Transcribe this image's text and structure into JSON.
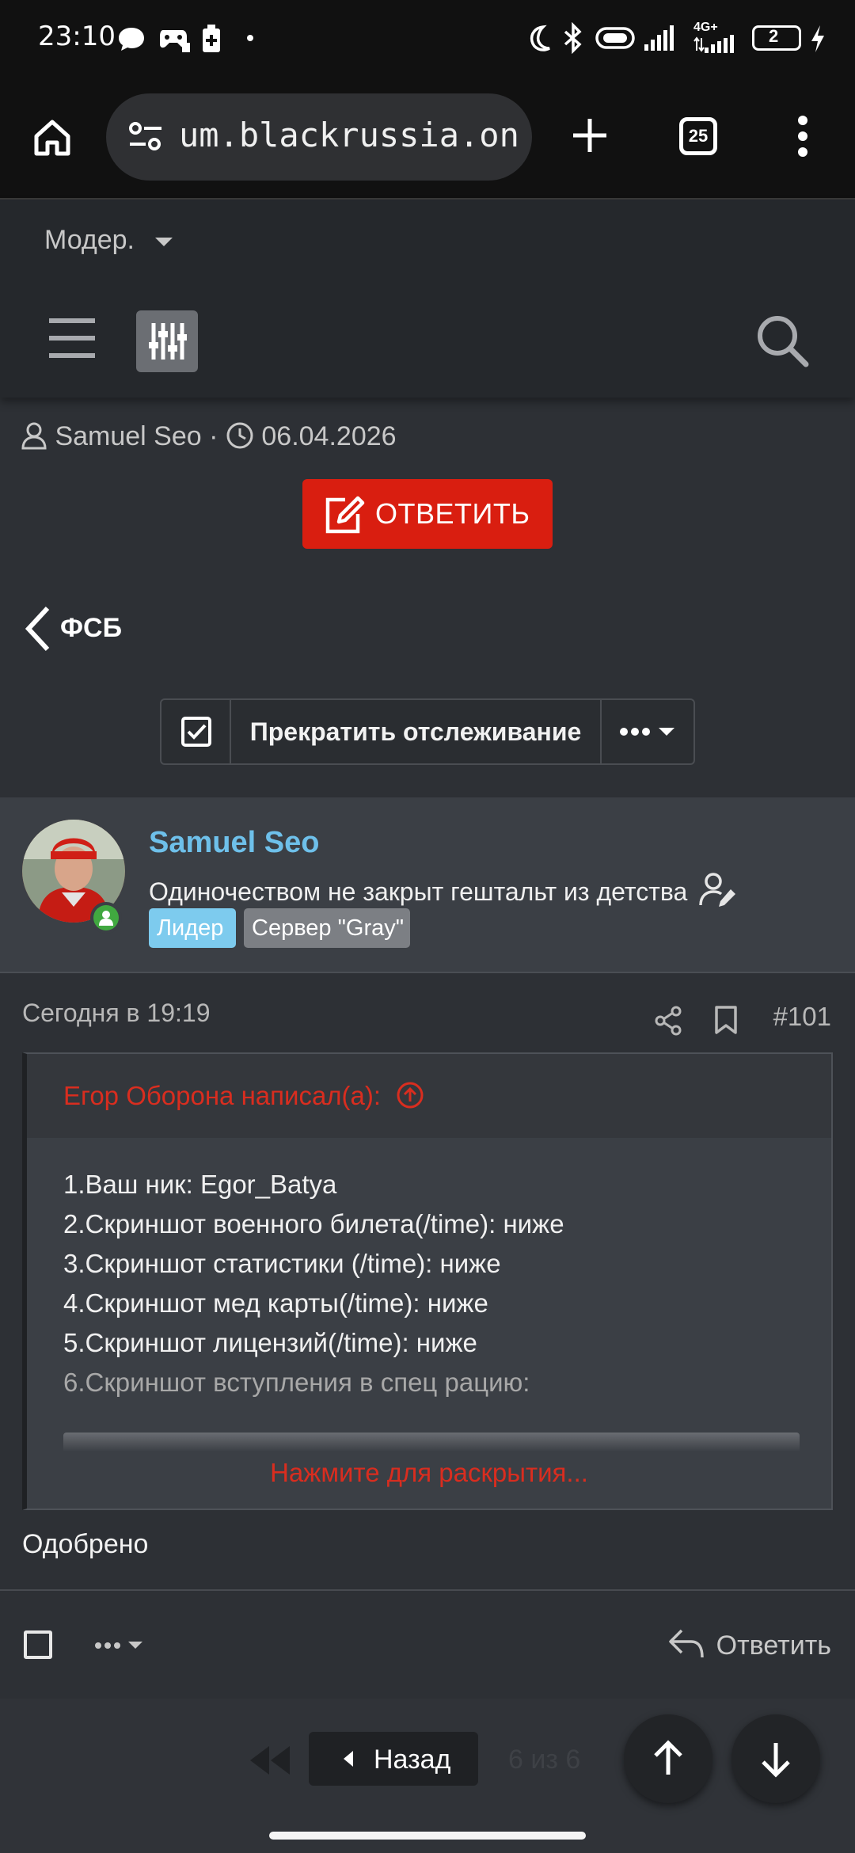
{
  "status_bar": {
    "time": "23:10",
    "network": "4G+",
    "battery": "2"
  },
  "browser": {
    "url": "um.blackrussia.online",
    "tab_count": "25"
  },
  "site_header": {
    "mod_label": "Модер."
  },
  "thread": {
    "author": "Samuel Seo",
    "separator": "·",
    "date": "06.04.2026",
    "reply_label": "ОТВЕТИТЬ",
    "back_forum": "ФСБ",
    "watch_label": "Прекратить отслеживание"
  },
  "post": {
    "username": "Samuel Seo",
    "user_title": "Одиночеством не закрыт гештальт из детства",
    "badges": [
      "Лидер",
      "Сервер \"Gray\""
    ],
    "date": "Сегодня в 19:19",
    "number": "#101",
    "quote": {
      "author": "Егор Оборона написал(а):",
      "lines": [
        "1.Ваш ник: Egor_Batya",
        "2.Скриншот военного билета(/time): ниже",
        "3.Скриншот статистики (/time): ниже",
        "4.Скриншот мед карты(/time): ниже",
        "5.Скриншот лицензий(/time): ниже",
        "6.Скриншот вступления в спец рацию:"
      ],
      "expand_label": "Нажмите для раскрытия..."
    },
    "text": "Одобрено",
    "reply_action": "Ответить"
  },
  "pagination": {
    "back_label": "Назад",
    "page_info": "6 из 6"
  },
  "colors": {
    "accent_red": "#d91e10",
    "username_blue": "#6ec0ea",
    "online_green": "#41a840"
  }
}
